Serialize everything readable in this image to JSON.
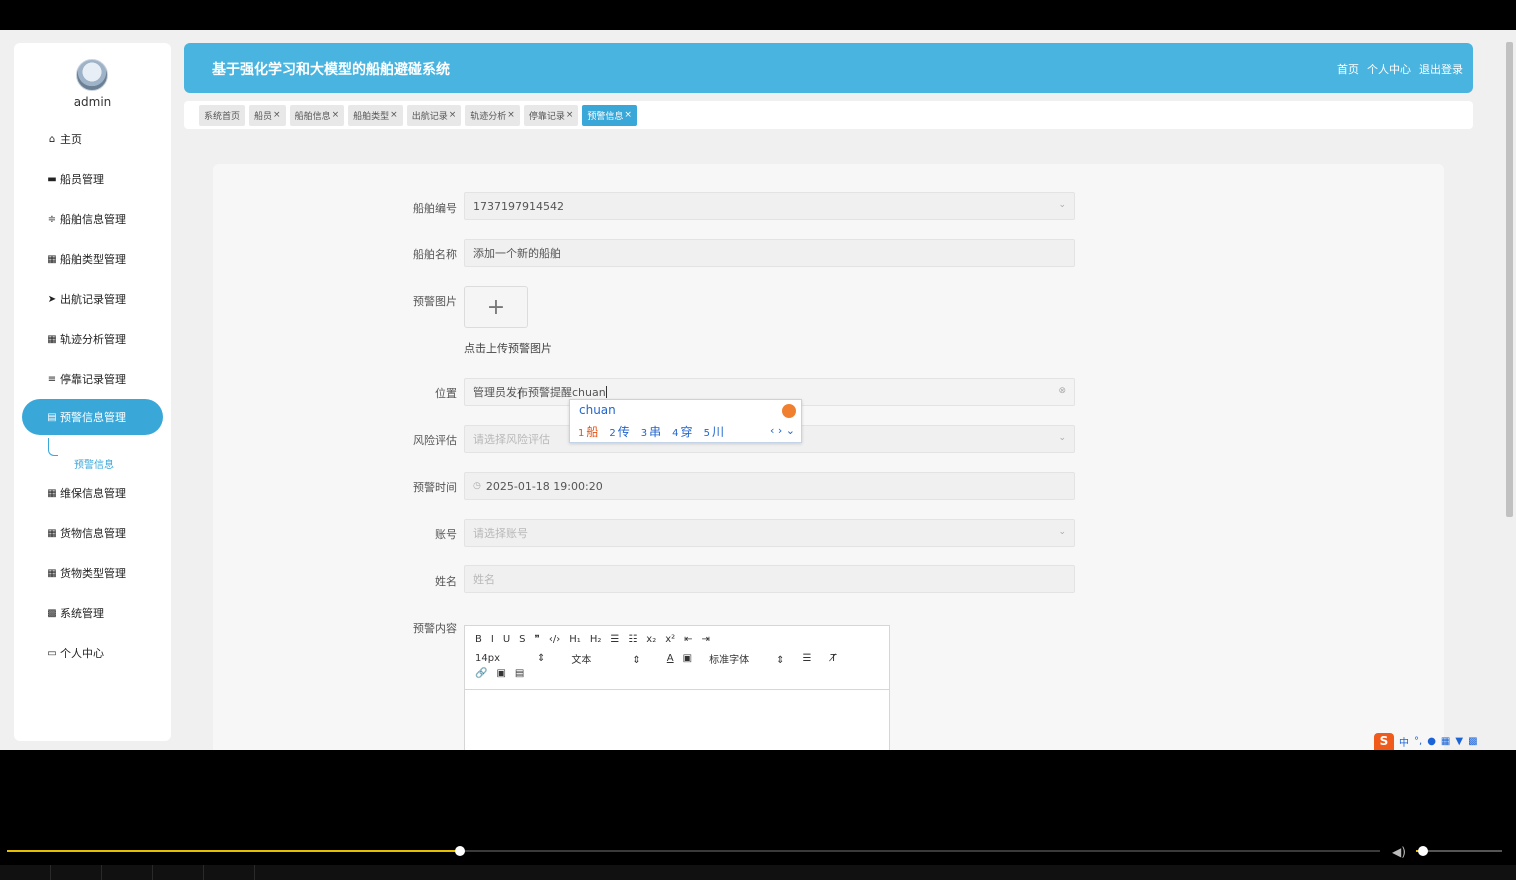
{
  "app": {
    "title": "基于强化学习和大模型的船舶避碰系统",
    "header_links": [
      "首页",
      "个人中心",
      "退出登录"
    ],
    "username": "admin"
  },
  "sidebar": {
    "items": [
      {
        "label": "主页",
        "icon": "home-icon",
        "glyph": "⌂"
      },
      {
        "label": "船员管理",
        "icon": "desktop-icon",
        "glyph": "▬"
      },
      {
        "label": "船舶信息管理",
        "icon": "sliders-icon",
        "glyph": "≑"
      },
      {
        "label": "船舶类型管理",
        "icon": "grid-icon",
        "glyph": "▦"
      },
      {
        "label": "出航记录管理",
        "icon": "paper-plane-icon",
        "glyph": "➤"
      },
      {
        "label": "轨迹分析管理",
        "icon": "grid-icon",
        "glyph": "▦"
      },
      {
        "label": "停靠记录管理",
        "icon": "list-icon",
        "glyph": "≡"
      },
      {
        "label": "预警信息管理",
        "icon": "clipboard-icon",
        "glyph": "▤"
      },
      {
        "label": "维保信息管理",
        "icon": "grid-icon",
        "glyph": "▦"
      },
      {
        "label": "货物信息管理",
        "icon": "grid-icon",
        "glyph": "▦"
      },
      {
        "label": "货物类型管理",
        "icon": "grid-icon",
        "glyph": "▦"
      },
      {
        "label": "系统管理",
        "icon": "apps-icon",
        "glyph": "▩"
      },
      {
        "label": "个人中心",
        "icon": "id-card-icon",
        "glyph": "▭"
      }
    ],
    "submenu": "预警信息"
  },
  "tabs": [
    {
      "label": "系统首页",
      "closable": false
    },
    {
      "label": "船员",
      "closable": true
    },
    {
      "label": "船舶信息",
      "closable": true
    },
    {
      "label": "船舶类型",
      "closable": true
    },
    {
      "label": "出航记录",
      "closable": true
    },
    {
      "label": "轨迹分析",
      "closable": true
    },
    {
      "label": "停靠记录",
      "closable": true
    },
    {
      "label": "预警信息",
      "closable": true,
      "active": true
    }
  ],
  "form": {
    "ship_no_label": "船舶编号",
    "ship_no_value": "1737197914542",
    "ship_name_label": "船舶名称",
    "ship_name_value": "添加一个新的船舶",
    "image_label": "预警图片",
    "upload_hint": "点击上传预警图片",
    "location_label": "位置",
    "location_value": "管理员发布预警提醒chuan",
    "risk_label": "风险评估",
    "risk_placeholder": "请选择风险评估",
    "time_label": "预警时间",
    "time_value": "2025-01-18 19:00:20",
    "account_label": "账号",
    "account_placeholder": "请选择账号",
    "name_label": "姓名",
    "name_placeholder": "姓名",
    "content_label": "预警内容"
  },
  "editor": {
    "row1": [
      "B",
      "I",
      "U",
      "S",
      "❞",
      "‹/›",
      "H₁",
      "H₂",
      "☰",
      "☷",
      "x₂",
      "x²",
      "⇤",
      "⇥"
    ],
    "font_size": "14px",
    "text_style": "文本",
    "font_family": "标准字体",
    "row3": [
      "🔗",
      "▣",
      "▤"
    ]
  },
  "ime": {
    "input": "chuan",
    "candidates": [
      {
        "n": "1",
        "c": "船"
      },
      {
        "n": "2",
        "c": "传"
      },
      {
        "n": "3",
        "c": "串"
      },
      {
        "n": "4",
        "c": "穿"
      },
      {
        "n": "5",
        "c": "川"
      }
    ]
  },
  "tray": {
    "lang": "中",
    "punct": "°,"
  },
  "player": {
    "progress": 0.33,
    "volume": 0.08
  },
  "colors": {
    "accent": "#3aa7d9",
    "header": "#49b4e0",
    "progress": "#e5c000"
  }
}
